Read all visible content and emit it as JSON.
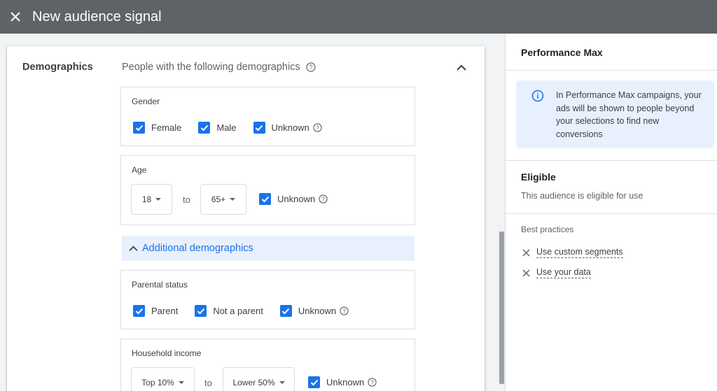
{
  "header": {
    "title": "New audience signal",
    "close_icon": "close-icon"
  },
  "demographics": {
    "label": "Demographics",
    "description": "People with the following demographics",
    "gender": {
      "label": "Gender",
      "options": [
        {
          "label": "Female",
          "checked": true
        },
        {
          "label": "Male",
          "checked": true
        },
        {
          "label": "Unknown",
          "checked": true
        }
      ]
    },
    "age": {
      "label": "Age",
      "from": "18",
      "to_label": "to",
      "to": "65+",
      "unknown_label": "Unknown",
      "unknown_checked": true
    },
    "additional": {
      "label": "Additional demographics"
    },
    "parental": {
      "label": "Parental status",
      "options": [
        {
          "label": "Parent",
          "checked": true
        },
        {
          "label": "Not a parent",
          "checked": true
        },
        {
          "label": "Unknown",
          "checked": true
        }
      ]
    },
    "income": {
      "label": "Household income",
      "from": "Top 10%",
      "to_label": "to",
      "to": "Lower 50%",
      "unknown_label": "Unknown",
      "unknown_checked": true
    }
  },
  "sidebar": {
    "title": "Performance Max",
    "info": "In Performance Max campaigns, your ads will be shown to people beyond your selections to find new conversions",
    "eligible_title": "Eligible",
    "eligible_desc": "This audience is eligible for use",
    "best_practices_title": "Best practices",
    "best_practices": [
      "Use custom segments",
      "Use your data"
    ]
  },
  "colors": {
    "accent": "#1a73e8",
    "header_bg": "#5f6368",
    "info_bg": "#e8f0fe"
  }
}
